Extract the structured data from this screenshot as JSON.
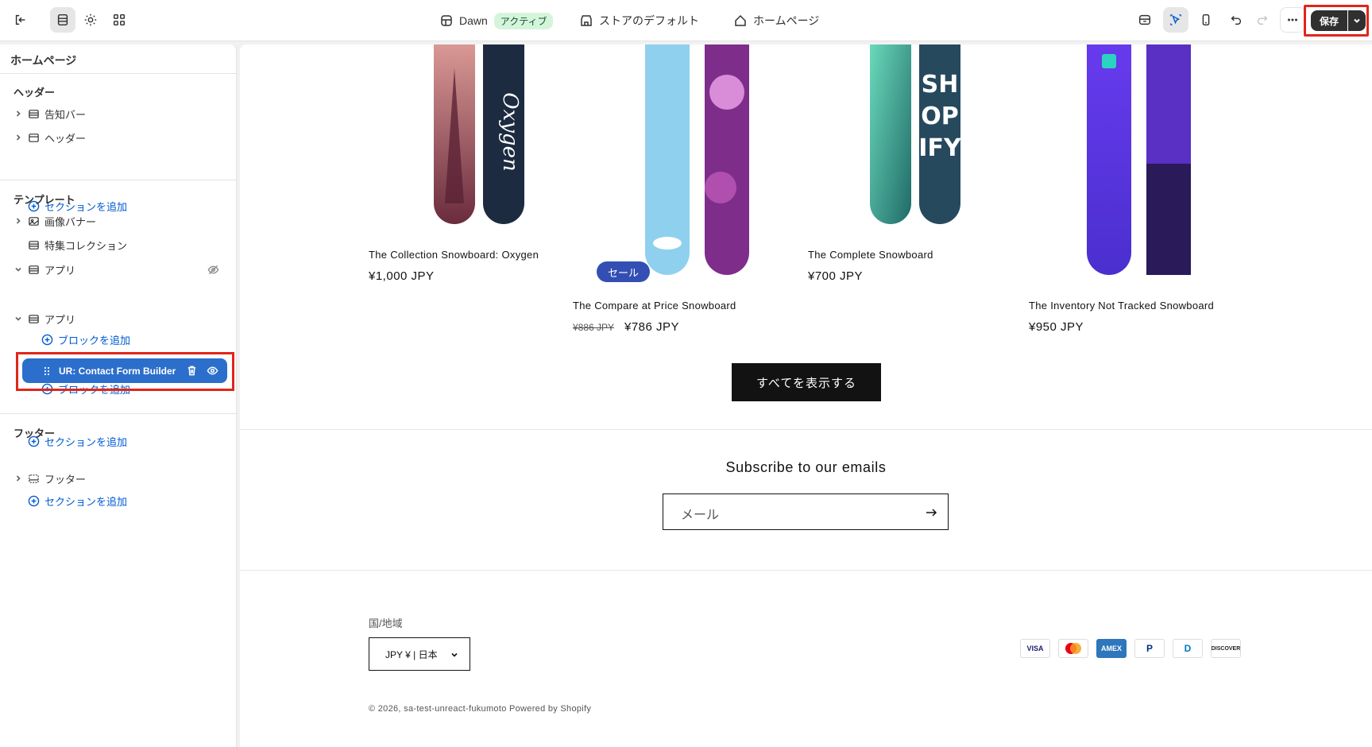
{
  "topbar": {
    "theme_name": "Dawn",
    "theme_status": "アクティブ",
    "store_default": "ストアのデフォルト",
    "page": "ホームページ",
    "save_label": "保存"
  },
  "sidebar": {
    "title": "ホームページ",
    "header_group": "ヘッダー",
    "header_items": [
      "告知バー",
      "ヘッダー"
    ],
    "add_section": "セクションを追加",
    "template_group": "テンプレート",
    "template_items": [
      "画像バナー",
      "特集コレクション",
      "アプリ",
      "アプリ"
    ],
    "add_block": "ブロックを追加",
    "selected_block": "UR: Contact Form Builder",
    "footer_group": "フッター",
    "footer_item": "フッター"
  },
  "products": [
    {
      "title": "The Collection Snowboard: Oxygen",
      "price": "¥1,000 JPY"
    },
    {
      "title": "The Compare at Price Snowboard",
      "old_price": "¥886 JPY",
      "price": "¥786 JPY",
      "badge": "セール"
    },
    {
      "title": "The Complete Snowboard",
      "price": "¥700 JPY"
    },
    {
      "title": "The Inventory Not Tracked Snowboard",
      "price": "¥950 JPY"
    }
  ],
  "view_all": "すべてを表示する",
  "newsletter": {
    "title": "Subscribe to our emails",
    "placeholder": "メール"
  },
  "footer": {
    "country_label": "国/地域",
    "country_value": "JPY ¥ | 日本",
    "payments": [
      "VISA",
      "Mastercard",
      "AMEX",
      "PayPal",
      "Diners",
      "DISCOVER"
    ],
    "copyright": "© 2026, sa-test-unreact-fukumoto Powered by Shopify"
  }
}
